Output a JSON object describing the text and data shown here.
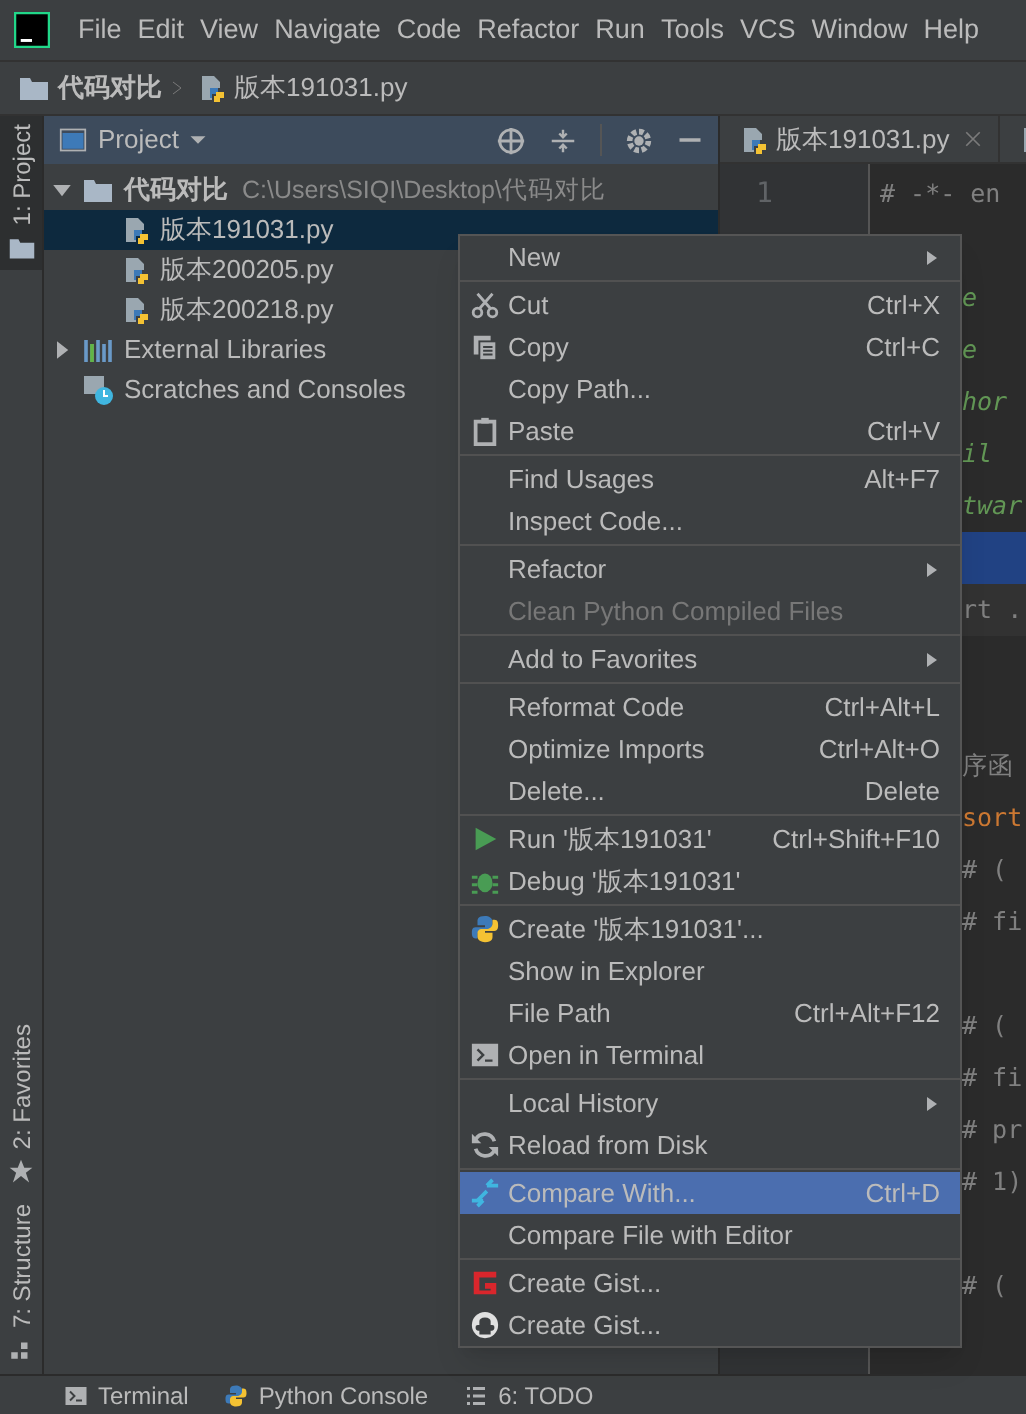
{
  "menu_bar": {
    "items": [
      "File",
      "Edit",
      "View",
      "Navigate",
      "Code",
      "Refactor",
      "Run",
      "Tools",
      "VCS",
      "Window",
      "Help"
    ]
  },
  "breadcrumb": {
    "folder": "代码对比",
    "file": "版本191031.py"
  },
  "tool_strip": {
    "top": [
      {
        "label": "1: Project",
        "selected": true
      }
    ],
    "bottom": [
      {
        "label": "2: Favorites",
        "kind": "star"
      },
      {
        "label": "7: Structure",
        "kind": "structure"
      }
    ]
  },
  "project_panel": {
    "title": "Project",
    "tree": [
      {
        "label": "代码对比",
        "path": "C:\\Users\\SIQI\\Desktop\\代码对比",
        "kind": "folder",
        "expanded": true,
        "selected": false,
        "children": [
          {
            "label": "版本191031.py",
            "kind": "python",
            "selected": true
          },
          {
            "label": "版本200205.py",
            "kind": "python",
            "selected": false
          },
          {
            "label": "版本200218.py",
            "kind": "python",
            "selected": false
          }
        ]
      },
      {
        "label": "External Libraries",
        "kind": "library",
        "expanded": false,
        "selected": false
      },
      {
        "label": "Scratches and Consoles",
        "kind": "scratch",
        "selected": false
      }
    ]
  },
  "editor": {
    "tabs": [
      {
        "label": "版本191031.py",
        "closable": true
      },
      {
        "closable": false
      }
    ],
    "gutter": [
      "1"
    ],
    "lines": [
      {
        "text": "# -*- en",
        "kind": "comment",
        "selected": false
      },
      {
        "selected": false
      },
      {
        "text": "e",
        "kind": "doc",
        "selected": false
      },
      {
        "text": "e",
        "kind": "doc",
        "selected": false
      },
      {
        "text": "hor",
        "kind": "doc",
        "selected": false
      },
      {
        "text": "il",
        "kind": "doc",
        "selected": false
      },
      {
        "text": "twar",
        "kind": "doc",
        "selected": false
      },
      {
        "selected": true
      },
      {
        "text": "rt .",
        "kind": "comment",
        "current": true,
        "selected": false
      },
      {
        "selected": false
      },
      {
        "selected": false
      },
      {
        "text": "序函",
        "kind": "comment",
        "selected": false
      },
      {
        "text": "sort",
        "kind": "keyword",
        "selected": false
      },
      {
        "text": "# (",
        "kind": "comment",
        "selected": false
      },
      {
        "text": "# fi",
        "kind": "comment",
        "selected": false
      },
      {
        "selected": false
      },
      {
        "text": "# (",
        "kind": "comment",
        "selected": false
      },
      {
        "text": "# fi",
        "kind": "comment",
        "selected": false
      },
      {
        "text": "# pr",
        "kind": "comment",
        "selected": false
      },
      {
        "text": "# 1)",
        "kind": "comment",
        "selected": false
      },
      {
        "selected": false
      },
      {
        "text": "# (",
        "kind": "comment",
        "selected": false
      }
    ]
  },
  "context_menu": {
    "groups": [
      [
        {
          "label": "New",
          "submenu": true
        }
      ],
      [
        {
          "label": "Cut",
          "shortcut": "Ctrl+X",
          "kind": "scissors"
        },
        {
          "label": "Copy",
          "shortcut": "Ctrl+C",
          "kind": "copy"
        },
        {
          "label": "Copy Path..."
        },
        {
          "label": "Paste",
          "shortcut": "Ctrl+V",
          "kind": "clipboard"
        }
      ],
      [
        {
          "label": "Find Usages",
          "shortcut": "Alt+F7"
        },
        {
          "label": "Inspect Code..."
        }
      ],
      [
        {
          "label": "Refactor",
          "submenu": true
        },
        {
          "label": "Clean Python Compiled Files",
          "disabled": true
        }
      ],
      [
        {
          "label": "Add to Favorites",
          "submenu": true
        }
      ],
      [
        {
          "label": "Reformat Code",
          "shortcut": "Ctrl+Alt+L"
        },
        {
          "label": "Optimize Imports",
          "shortcut": "Ctrl+Alt+O"
        },
        {
          "label": "Delete...",
          "shortcut": "Delete"
        }
      ],
      [
        {
          "label": "Run '版本191031'",
          "shortcut": "Ctrl+Shift+F10",
          "kind": "play"
        },
        {
          "label": "Debug '版本191031'",
          "kind": "bug"
        }
      ],
      [
        {
          "label": "Create '版本191031'...",
          "kind": "python"
        },
        {
          "label": "Show in Explorer"
        },
        {
          "label": "File Path",
          "shortcut": "Ctrl+Alt+F12"
        },
        {
          "label": "Open in Terminal",
          "kind": "terminal"
        }
      ],
      [
        {
          "label": "Local History",
          "submenu": true
        },
        {
          "label": "Reload from Disk",
          "kind": "reload"
        }
      ],
      [
        {
          "label": "Compare With...",
          "shortcut": "Ctrl+D",
          "kind": "compare",
          "selected": true
        },
        {
          "label": "Compare File with Editor"
        }
      ],
      [
        {
          "label": "Create Gist...",
          "kind": "gist"
        },
        {
          "label": "Create Gist...",
          "kind": "github"
        }
      ]
    ]
  },
  "bottom_bar": [
    {
      "label": "Terminal",
      "kind": "terminal"
    },
    {
      "label": "Python Console",
      "kind": "python"
    },
    {
      "label": "6: TODO",
      "kind": "list"
    }
  ]
}
